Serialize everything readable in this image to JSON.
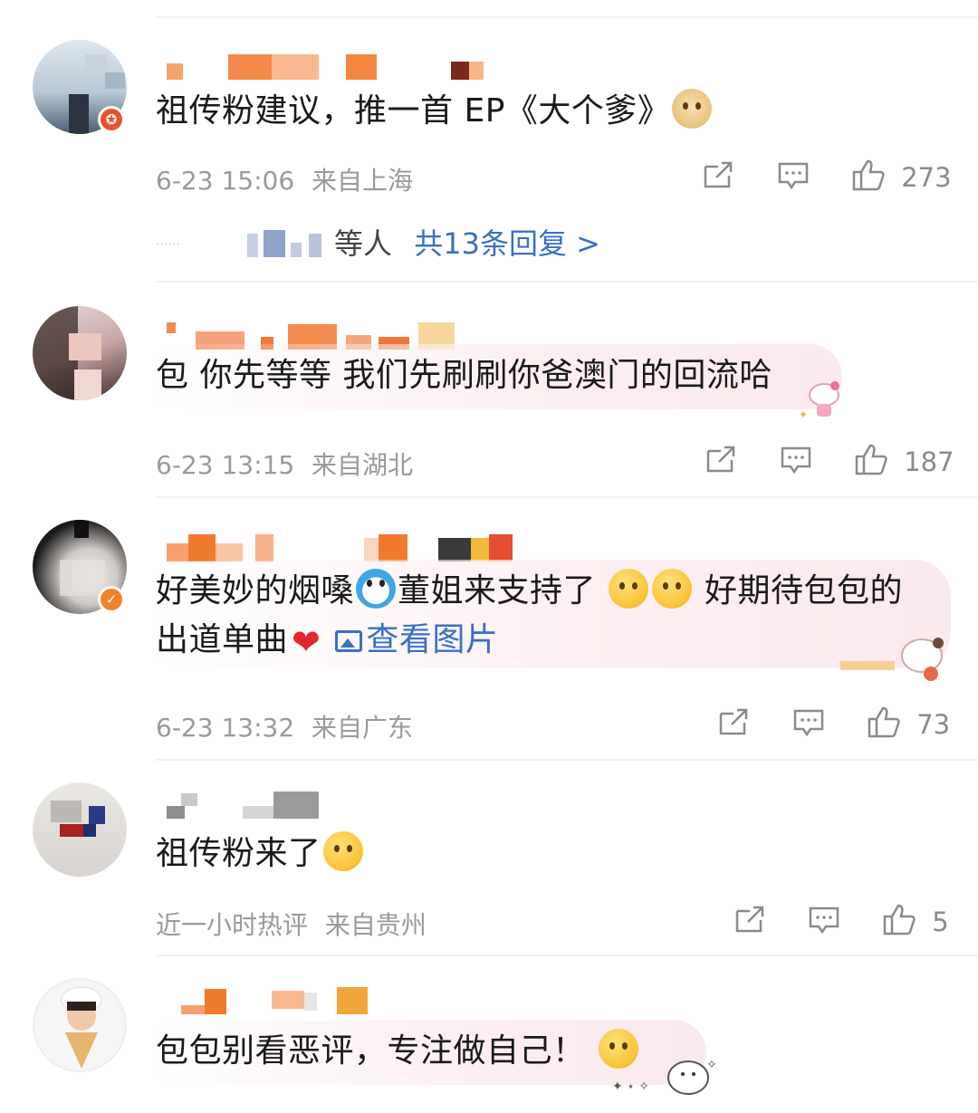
{
  "comments": [
    {
      "text": "祖传粉建议，推一首 EP《大个爹》",
      "time": "6-23 15:06",
      "location": "来自上海",
      "likes": "273",
      "replies": {
        "prefix": "······",
        "who": "等人",
        "link": "共13条回复 >"
      },
      "badge_icon": "star-icon",
      "badge_color": "#e8532f"
    },
    {
      "text": "包 你先等等 我们先刷刷你爸澳门的回流哈",
      "time": "6-23 13:15",
      "location": "来自湖北",
      "likes": "187"
    },
    {
      "text_line1_a": "好美妙的烟嗓",
      "text_line1_b": "董姐来支持了",
      "text_line1_c": "好期待包包的",
      "text_line2": "出道单曲",
      "image_link": "查看图片",
      "time": "6-23 13:32",
      "location": "来自广东",
      "likes": "73",
      "badge_icon": "verified-icon",
      "badge_color": "#f0822a"
    },
    {
      "text": "祖传粉来了",
      "time": "近一小时热评",
      "location": "来自贵州",
      "likes": "5"
    },
    {
      "text": "包包别看恶评，专注做自己！"
    }
  ],
  "colors": {
    "link": "#3a6fc4",
    "meta": "#9a9a9a",
    "name_pixels": "#f07a2c"
  }
}
